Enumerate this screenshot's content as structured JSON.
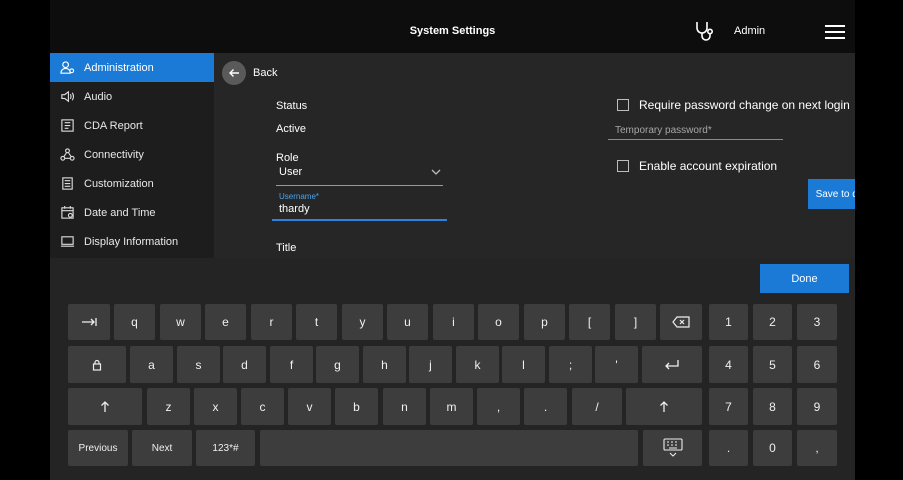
{
  "header": {
    "title": "System Settings",
    "user": "Admin"
  },
  "sidebar": {
    "items": [
      {
        "label": "Administration",
        "icon": "admin-user-icon",
        "active": true
      },
      {
        "label": "Audio",
        "icon": "speaker-icon"
      },
      {
        "label": "CDA Report",
        "icon": "report-icon"
      },
      {
        "label": "Connectivity",
        "icon": "network-icon"
      },
      {
        "label": "Customization",
        "icon": "customization-icon"
      },
      {
        "label": "Date and Time",
        "icon": "calendar-icon"
      },
      {
        "label": "Display Information",
        "icon": "monitor-icon"
      }
    ]
  },
  "form": {
    "back_label": "Back",
    "status_label": "Status",
    "status_value": "Active",
    "role_label": "Role",
    "role_value": "User",
    "username_label": "Username*",
    "username_value": "thardy",
    "title_label": "Title",
    "require_pw_label": "Require password change on next login",
    "temp_pw_placeholder": "Temporary password*",
    "expiration_label": "Enable account expiration",
    "save_label": "Save to database"
  },
  "keyboard": {
    "done_label": "Done",
    "row1": [
      "q",
      "w",
      "e",
      "r",
      "t",
      "y",
      "u",
      "i",
      "o",
      "p",
      "[",
      "]"
    ],
    "row2": [
      "a",
      "s",
      "d",
      "f",
      "g",
      "h",
      "j",
      "k",
      "l",
      ";",
      "'"
    ],
    "row3": [
      "z",
      "x",
      "c",
      "v",
      "b",
      "n",
      "m",
      ",",
      ".",
      "/"
    ],
    "previous_label": "Previous",
    "next_label": "Next",
    "symbols_label": "123*#",
    "numpad": [
      "1",
      "2",
      "3",
      "4",
      "5",
      "6",
      "7",
      "8",
      "9",
      ".",
      "0",
      ","
    ]
  },
  "colors": {
    "accent": "#1a7ad6",
    "topbar": "#0d0d0d",
    "key": "#3d3d3d"
  }
}
